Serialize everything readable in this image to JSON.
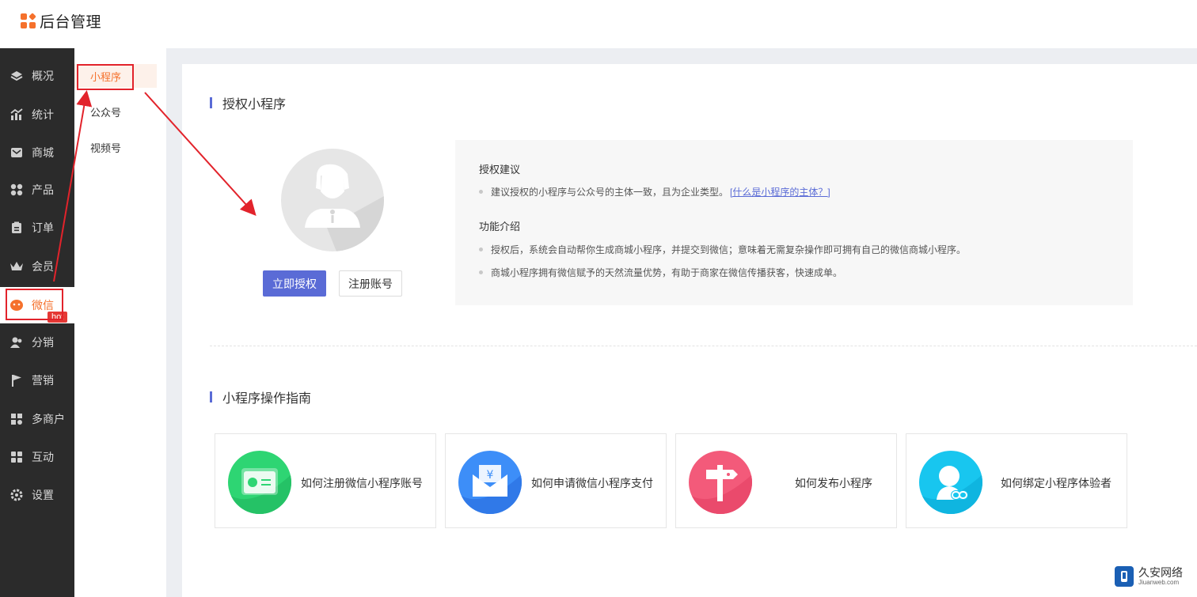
{
  "app": {
    "title": "后台管理"
  },
  "sidebar": {
    "items": [
      {
        "label": "概况",
        "icon": "layers-icon"
      },
      {
        "label": "统计",
        "icon": "chart-icon"
      },
      {
        "label": "商城",
        "icon": "mail-icon"
      },
      {
        "label": "产品",
        "icon": "grid-icon"
      },
      {
        "label": "订单",
        "icon": "clipboard-icon"
      },
      {
        "label": "会员",
        "icon": "crown-icon"
      },
      {
        "label": "微信",
        "icon": "wechat-icon",
        "active": true
      },
      {
        "label": "分销",
        "icon": "users-icon"
      },
      {
        "label": "营销",
        "icon": "flag-icon",
        "badge": "hot"
      },
      {
        "label": "多商户",
        "icon": "store-icon"
      },
      {
        "label": "互动",
        "icon": "interact-icon"
      },
      {
        "label": "设置",
        "icon": "gear-icon"
      }
    ]
  },
  "subnav": {
    "items": [
      {
        "label": "小程序",
        "active": true
      },
      {
        "label": "公众号"
      },
      {
        "label": "视频号"
      }
    ]
  },
  "auth": {
    "title": "授权小程序",
    "authorize_button": "立即授权",
    "register_button": "注册账号",
    "suggest_title": "授权建议",
    "suggest_text": "建议授权的小程序与公众号的主体一致，且为企业类型。",
    "suggest_link": "[什么是小程序的主体？]",
    "feature_title": "功能介绍",
    "feature_items": [
      "授权后，系统会自动帮你生成商城小程序，并提交到微信；意味着无需复杂操作即可拥有自己的微信商城小程序。",
      "商城小程序拥有微信赋予的天然流量优势，有助于商家在微信传播获客，快速成单。"
    ]
  },
  "guide": {
    "title": "小程序操作指南",
    "cards": [
      {
        "label": "如何注册微信小程序账号",
        "icon": "register-card-icon",
        "color": "#2ed573"
      },
      {
        "label": "如何申请微信小程序支付",
        "icon": "payment-envelope-icon",
        "color": "#3d8ef8"
      },
      {
        "label": "如何发布小程序",
        "icon": "signpost-icon",
        "color": "#f35a7a"
      },
      {
        "label": "如何绑定小程序体验者",
        "icon": "user-link-icon",
        "color": "#18c6ef"
      }
    ]
  },
  "colors": {
    "accent": "#f5712c",
    "primary": "#5a6bd6",
    "sidebar_bg": "#2b2b2b",
    "highlight": "#e2232b"
  },
  "watermark": {
    "title": "久安网络",
    "subtitle": "Jiuanweb.com"
  }
}
